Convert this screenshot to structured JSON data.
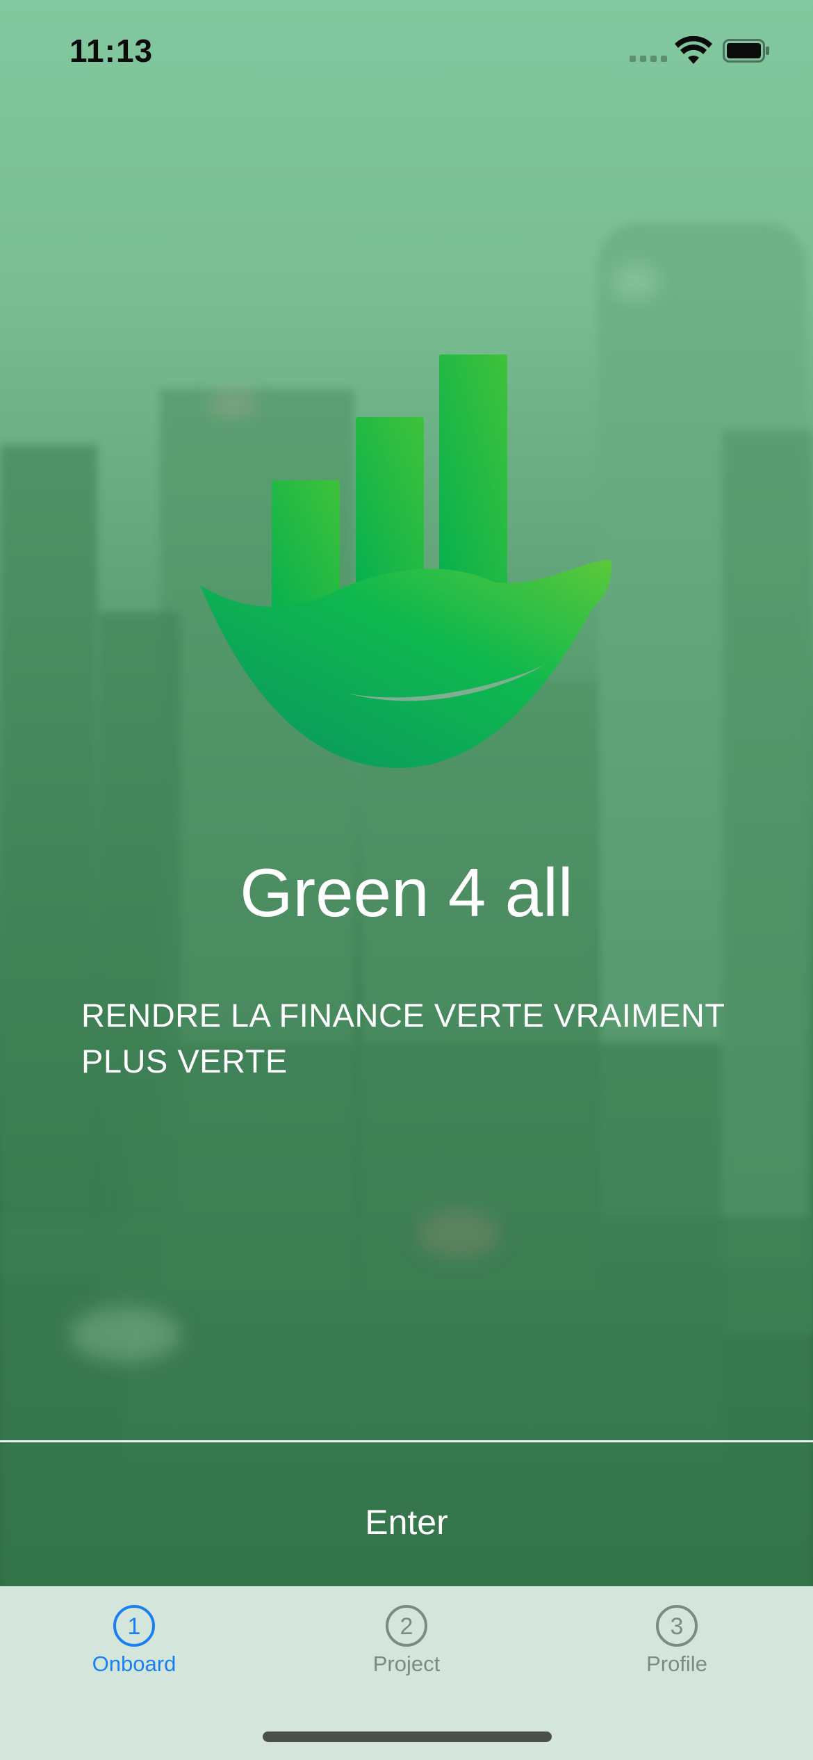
{
  "status_bar": {
    "time": "11:13"
  },
  "hero": {
    "title": "Green 4 all",
    "subtitle": "RENDRE LA FINANCE VERTE VRAIMENT PLUS VERTE"
  },
  "action": {
    "enter_label": "Enter"
  },
  "tab_bar": {
    "tabs": [
      {
        "number": "1",
        "label": "Onboard",
        "selected": true
      },
      {
        "number": "2",
        "label": "Project",
        "selected": false
      },
      {
        "number": "3",
        "label": "Profile",
        "selected": false
      }
    ]
  },
  "colors": {
    "accent": "#1a7ff2",
    "inactive_tab": "#7c8a82",
    "tab_bar_bg": "#d4e6dc",
    "logo_green_light": "#4cc83a",
    "logo_green_dark": "#0a9c60"
  },
  "icons": [
    "wifi-icon",
    "battery-icon",
    "signal-icon",
    "leaf-chart-logo"
  ]
}
